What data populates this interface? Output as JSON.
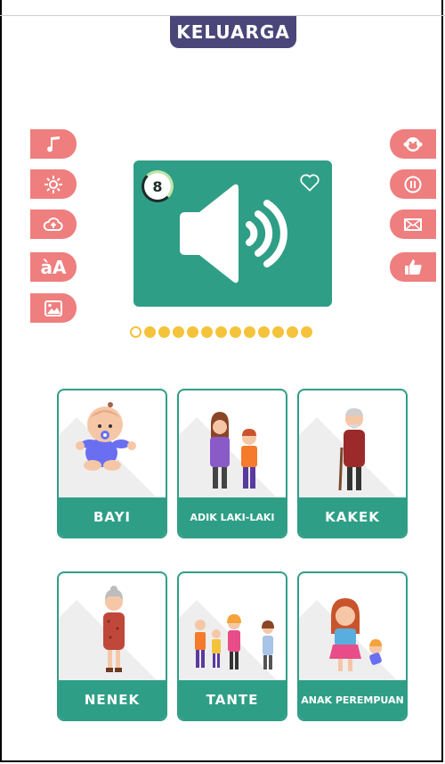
{
  "header": {
    "title": "KELUARGA"
  },
  "left_toolbar": [
    {
      "icon": "music-note-icon"
    },
    {
      "icon": "brightness-icon"
    },
    {
      "icon": "cloud-upload-icon"
    },
    {
      "icon": "font-size-icon",
      "text": "àA"
    },
    {
      "icon": "image-icon"
    }
  ],
  "right_toolbar": [
    {
      "icon": "monkey-face-icon"
    },
    {
      "icon": "pause-icon"
    },
    {
      "icon": "mail-icon"
    },
    {
      "icon": "thumbs-up-icon"
    }
  ],
  "main_card": {
    "timer": "8",
    "colors": {
      "card": "#2f9e86",
      "accent": "#f5c33b",
      "button": "#ef7e7e"
    }
  },
  "progress": {
    "total": 13,
    "current": 1
  },
  "cards": [
    {
      "label": "BAYI"
    },
    {
      "label": "ADIK LAKI-LAKI"
    },
    {
      "label": "KAKEK"
    },
    {
      "label": "NENEK"
    },
    {
      "label": "TANTE"
    },
    {
      "label": "ANAK PEREMPUAN"
    }
  ]
}
